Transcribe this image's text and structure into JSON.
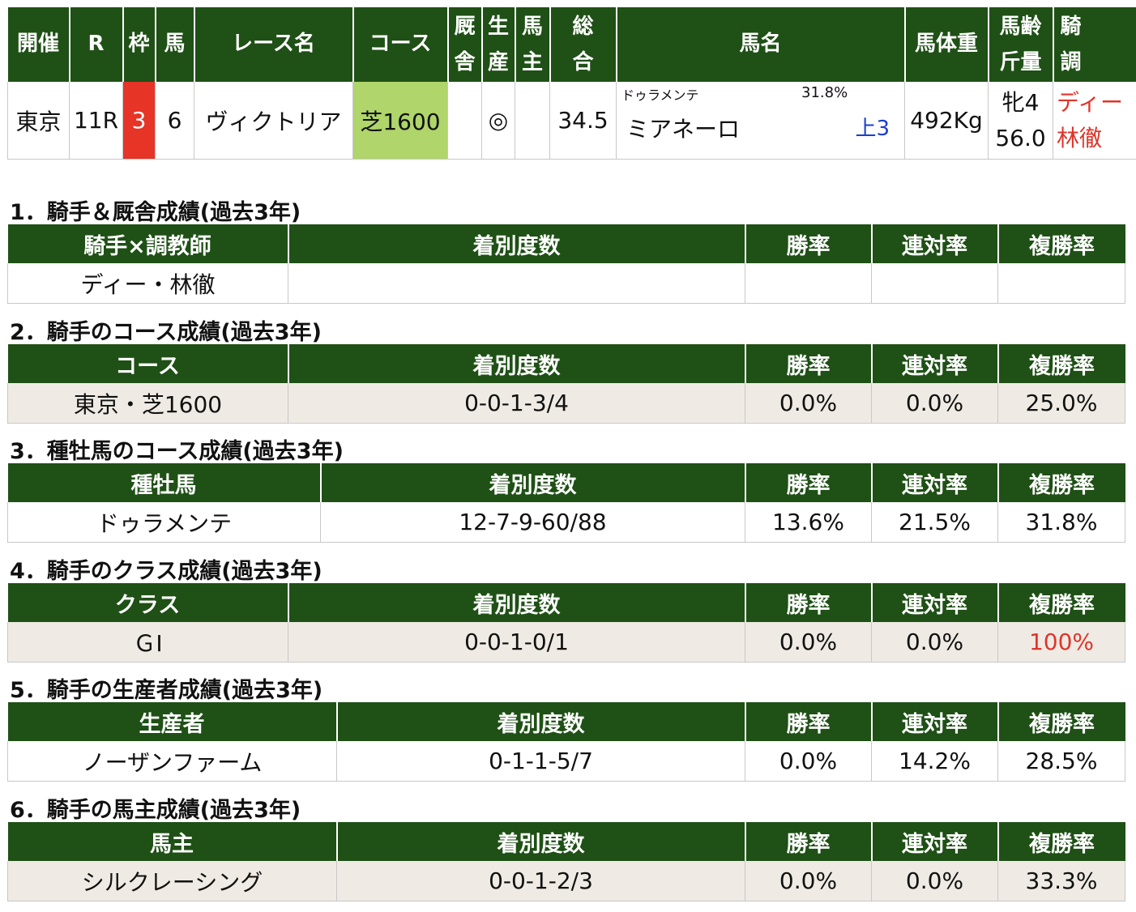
{
  "race_table": {
    "headers": {
      "kaisai": "開催",
      "r": "R",
      "waku": "枠",
      "uma": "馬",
      "race_name": "レース名",
      "course": "コース",
      "kyusha_1": "厩",
      "kyusha_2": "舎",
      "seisan_1": "生",
      "seisan_2": "産",
      "banushi_1": "馬",
      "banushi_2": "主",
      "sogo_1": "総",
      "sogo_2": "合",
      "horse_name": "馬名",
      "weight": "馬体重",
      "age_1": "馬齢",
      "age_2": "斤量",
      "jockey_1": "騎",
      "jockey_2": "調"
    },
    "row": {
      "kaisai": "東京",
      "r": "11R",
      "waku": "3",
      "uma": "6",
      "race_name": "ヴィクトリア",
      "course": "芝1600",
      "kyusha": "",
      "seisan": "◎",
      "banushi": "",
      "sogo": "34.5",
      "sire": "ドゥラメンテ",
      "sire_rate": "31.8%",
      "horse_name": "ミアネーロ",
      "popularity": "上3",
      "weight": "492Kg",
      "sex_age": "牝4",
      "kinryo": "56.0",
      "jockey": "ディー",
      "trainer": "林徹"
    },
    "colors": {
      "header": "#1f5016",
      "waku3": "#e63426",
      "turf": "#afd56b",
      "popularity": "#1a3fd0",
      "jockey": "#e0352b"
    }
  },
  "stat_headers": {
    "record": "着別度数",
    "win": "勝率",
    "rentai": "連対率",
    "fukusho": "複勝率"
  },
  "sections": [
    {
      "title": "1．騎手＆厩舎成績(過去3年)",
      "key_header": "騎手×調教師",
      "key": "ディー・林徹",
      "record": "",
      "win": "",
      "rentai": "",
      "fukusho": ""
    },
    {
      "title": "2．騎手のコース成績(過去3年)",
      "key_header": "コース",
      "key": "東京・芝1600",
      "record": "0-0-1-3/4",
      "win": "0.0%",
      "rentai": "0.0%",
      "fukusho": "25.0%"
    },
    {
      "title": "3．種牡馬のコース成績(過去3年)",
      "key_header": "種牡馬",
      "key": "ドゥラメンテ",
      "record": "12-7-9-60/88",
      "win": "13.6%",
      "rentai": "21.5%",
      "fukusho": "31.8%"
    },
    {
      "title": "4．騎手のクラス成績(過去3年)",
      "key_header": "クラス",
      "key": "ＧⅠ",
      "record": "0-0-1-0/1",
      "win": "0.0%",
      "rentai": "0.0%",
      "fukusho": "100%"
    },
    {
      "title": "5．騎手の生産者成績(過去3年)",
      "key_header": "生産者",
      "key": "ノーザンファーム",
      "record": "0-1-1-5/7",
      "win": "0.0%",
      "rentai": "14.2%",
      "fukusho": "28.5%"
    },
    {
      "title": "6．騎手の馬主成績(過去3年)",
      "key_header": "馬主",
      "key": "シルクレーシング",
      "record": "0-0-1-2/3",
      "win": "0.0%",
      "rentai": "0.0%",
      "fukusho": "33.3%"
    }
  ]
}
